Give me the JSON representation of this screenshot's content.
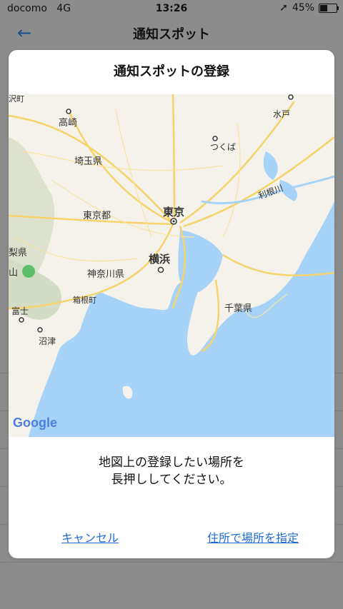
{
  "status": {
    "carrier": "docomo",
    "network": "4G",
    "time": "13:26",
    "battery": "45%",
    "battery_level": 0.45
  },
  "navbar": {
    "title": "通知スポット",
    "back_icon": "arrow-left-icon"
  },
  "modal": {
    "title": "通知スポットの登録",
    "instruction_line1": "地図上の登録したい場所を",
    "instruction_line2": "長押ししてください。",
    "cancel_label": "キャンセル",
    "address_label": "住所で場所を指定"
  },
  "map": {
    "labels": {
      "sawamachi": "沢町",
      "takasaki": "高崎",
      "mito": "水戸",
      "tsukuba": "つくば",
      "saitama": "埼玉県",
      "tokyo_to": "東京都",
      "tokyo": "東京",
      "tonegawa": "利根川",
      "yokohama": "横浜",
      "kanagawa": "神奈川県",
      "hakone": "箱根町",
      "chiba": "千葉県",
      "fuji": "富士",
      "numazu": "沼津",
      "yamanashi": "梨県",
      "yama": "山"
    },
    "google_logo": "Google"
  }
}
